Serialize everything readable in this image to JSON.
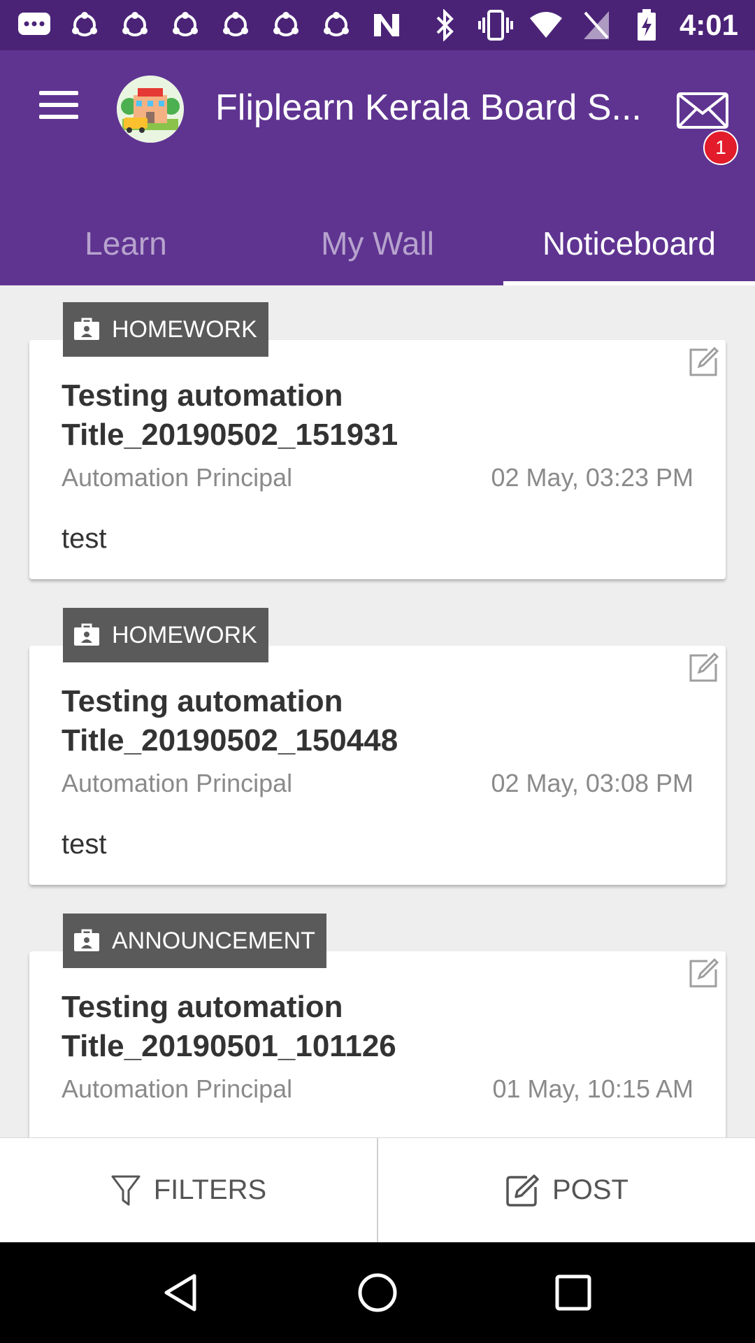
{
  "status_bar": {
    "time": "4:01",
    "left_icons": [
      "messages-icon",
      "group-icon",
      "group-icon",
      "group-icon",
      "group-icon",
      "group-icon",
      "group-icon",
      "nfc-icon"
    ],
    "right_icons": [
      "bluetooth-icon",
      "vibrate-icon",
      "wifi-icon",
      "no-sim-icon",
      "battery-charging-icon"
    ]
  },
  "app_bar": {
    "title": "Fliplearn Kerala Board S...",
    "notification_count": "1",
    "colors": {
      "primary": "#5f3491",
      "status": "#4a2377"
    }
  },
  "tabs": [
    {
      "label": "Learn",
      "active": false
    },
    {
      "label": "My Wall",
      "active": false
    },
    {
      "label": "Noticeboard",
      "active": true
    }
  ],
  "posts": [
    {
      "tag": "HOMEWORK",
      "title": "Testing automation Title_20190502_151931",
      "author": "Automation Principal",
      "date": "02 May, 03:23 PM",
      "body": "test"
    },
    {
      "tag": "HOMEWORK",
      "title": "Testing automation Title_20190502_150448",
      "author": "Automation Principal",
      "date": "02 May, 03:08 PM",
      "body": "test"
    },
    {
      "tag": "ANNOUNCEMENT",
      "title": "Testing automation Title_20190501_101126",
      "author": "Automation Principal",
      "date": "01 May, 10:15 AM",
      "body": ""
    }
  ],
  "actions": {
    "filters_label": "FILTERS",
    "post_label": "POST"
  }
}
